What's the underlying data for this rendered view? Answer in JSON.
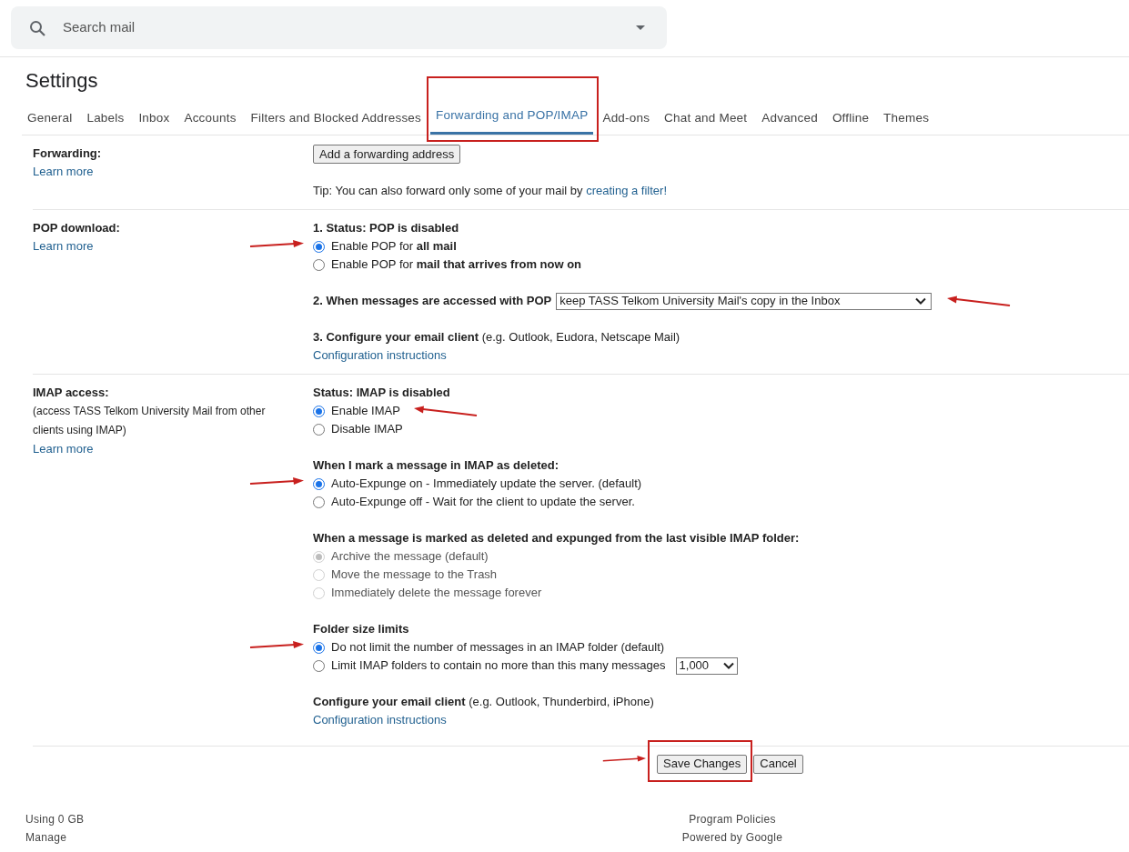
{
  "search": {
    "placeholder": "Search mail"
  },
  "title": "Settings",
  "tabs": [
    {
      "label": "General",
      "selected": false,
      "framed": false
    },
    {
      "label": "Labels",
      "selected": false,
      "framed": false
    },
    {
      "label": "Inbox",
      "selected": false,
      "framed": false
    },
    {
      "label": "Accounts",
      "selected": false,
      "framed": false
    },
    {
      "label": "Filters and Blocked Addresses",
      "selected": false,
      "framed": false
    },
    {
      "label": "Forwarding and POP/IMAP",
      "selected": true,
      "framed": true
    },
    {
      "label": "Add-ons",
      "selected": false,
      "framed": false
    },
    {
      "label": "Chat and Meet",
      "selected": false,
      "framed": false
    },
    {
      "label": "Advanced",
      "selected": false,
      "framed": false
    },
    {
      "label": "Offline",
      "selected": false,
      "framed": false
    },
    {
      "label": "Themes",
      "selected": false,
      "framed": false
    }
  ],
  "sections": [
    {
      "label": "Forwarding:",
      "learn_more": "Learn more",
      "content": [
        [
          {
            "kind": "button",
            "label": "Add a forwarding address"
          }
        ],
        [
          {
            "kind": "tip",
            "text": "Tip: You can also forward only some of your mail by ",
            "link": "creating a filter!"
          }
        ]
      ]
    },
    {
      "label": "POP download:",
      "learn_more": "Learn more",
      "content": [
        [
          {
            "kind": "heading",
            "text": "1. Status: POP is disabled"
          },
          {
            "kind": "radio",
            "options": [
              {
                "text": "Enable POP for **all mail**",
                "selected": true,
                "disabled": false,
                "arrow_left": true,
                "arrow_right": false
              },
              {
                "text": "Enable POP for **mail that arrives from now on**",
                "selected": false,
                "disabled": false,
                "arrow_left": false,
                "arrow_right": false
              }
            ]
          }
        ],
        [
          {
            "kind": "select",
            "label": "2. When messages are accessed with POP",
            "value": "keep TASS Telkom University Mail's copy in the Inbox",
            "arrow_right": true
          }
        ],
        [
          {
            "kind": "configure",
            "text": "**3. Configure your email client** (e.g. Outlook, Eudora, Netscape Mail)",
            "link": "Configuration instructions"
          }
        ]
      ]
    },
    {
      "label": "IMAP access:",
      "note": "(access TASS Telkom University Mail from other clients using IMAP)",
      "learn_more": "Learn more",
      "content": [
        [
          {
            "kind": "heading",
            "text": "Status: IMAP is disabled"
          },
          {
            "kind": "radio",
            "options": [
              {
                "text": "Enable IMAP",
                "selected": true,
                "disabled": false,
                "arrow_left": false,
                "arrow_right": true
              },
              {
                "text": "Disable IMAP",
                "selected": false,
                "disabled": false,
                "arrow_left": false,
                "arrow_right": false
              }
            ]
          }
        ],
        [
          {
            "kind": "heading",
            "text": "When I mark a message in IMAP as deleted:"
          },
          {
            "kind": "radio",
            "options": [
              {
                "text": "Auto-Expunge on - Immediately update the server. (default)",
                "selected": true,
                "disabled": false,
                "arrow_left": true,
                "arrow_right": false
              },
              {
                "text": "Auto-Expunge off - Wait for the client to update the server.",
                "selected": false,
                "disabled": false,
                "arrow_left": false,
                "arrow_right": false
              }
            ]
          }
        ],
        [
          {
            "kind": "heading",
            "text": "When a message is marked as deleted and expunged from the last visible IMAP folder:"
          },
          {
            "kind": "radio",
            "options": [
              {
                "text": "Archive the message (default)",
                "selected": true,
                "disabled": true,
                "arrow_left": false,
                "arrow_right": false
              },
              {
                "text": "Move the message to the Trash",
                "selected": false,
                "disabled": true,
                "arrow_left": false,
                "arrow_right": false
              },
              {
                "text": "Immediately delete the message forever",
                "selected": false,
                "disabled": true,
                "arrow_left": false,
                "arrow_right": false
              }
            ]
          }
        ],
        [
          {
            "kind": "heading",
            "text": "Folder size limits"
          },
          {
            "kind": "radio",
            "options": [
              {
                "text": "Do not limit the number of messages in an IMAP folder (default)",
                "selected": true,
                "disabled": false,
                "arrow_left": true,
                "arrow_right": false
              },
              {
                "text": "Limit IMAP folders to contain no more than this many messages",
                "selected": false,
                "disabled": false,
                "arrow_left": false,
                "arrow_right": false,
                "select_value": "1,000"
              }
            ]
          }
        ],
        [
          {
            "kind": "configure",
            "text": "**Configure your email client** (e.g. Outlook, Thunderbird, iPhone)",
            "link": "Configuration instructions"
          }
        ]
      ]
    }
  ],
  "actions": [
    {
      "label": "Save Changes",
      "framed": true,
      "arrow_left": true
    },
    {
      "label": "Cancel",
      "framed": false,
      "arrow_left": false
    }
  ],
  "footer": {
    "left": [
      "Using 0 GB",
      "Manage"
    ],
    "right": [
      "Program Policies",
      "Powered by Google"
    ]
  }
}
